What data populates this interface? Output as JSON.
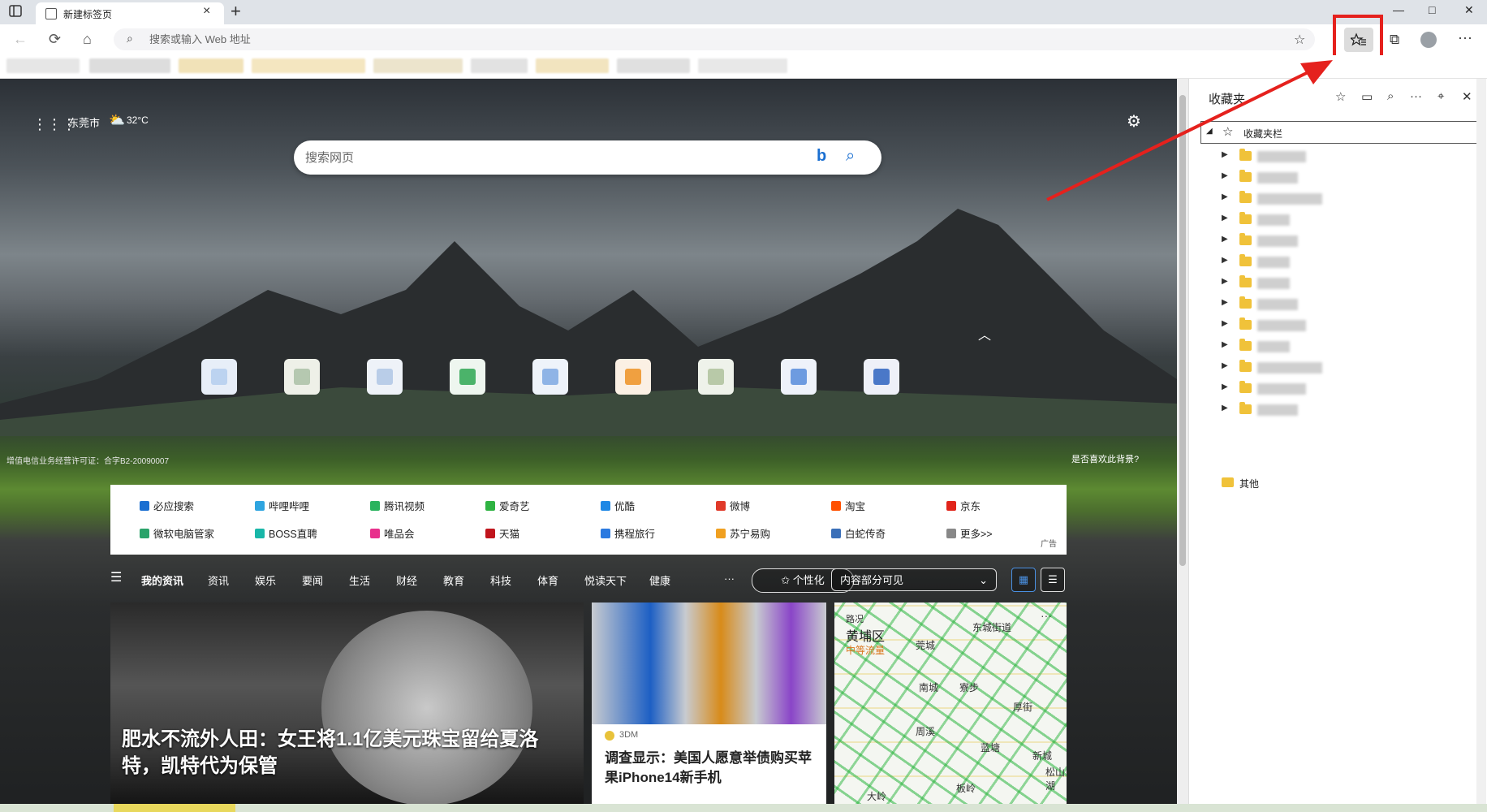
{
  "browser": {
    "tab_title": "新建标签页",
    "new_tab": "+",
    "address_placeholder": "搜索或输入 Web 地址",
    "window": {
      "minimize": "—",
      "maximize": "□",
      "close": "✕"
    }
  },
  "ntp": {
    "city": "东莞市",
    "temperature": "32°C",
    "search_placeholder": "搜索网页",
    "license": "增值电信业务经营许可证：合字B2-20090007",
    "like_background": "是否喜欢此背景?",
    "quick_links": [
      {
        "label": "必应搜索",
        "color": "#1a6fd1"
      },
      {
        "label": "哔哩哔哩",
        "color": "#2fa5e0"
      },
      {
        "label": "腾讯视频",
        "color": "#2ab35e"
      },
      {
        "label": "爱奇艺",
        "color": "#2fb342"
      },
      {
        "label": "优酷",
        "color": "#1e88e5"
      },
      {
        "label": "微博",
        "color": "#e03a2a"
      },
      {
        "label": "淘宝",
        "color": "#ff5000"
      },
      {
        "label": "京东",
        "color": "#e1251b"
      },
      {
        "label": "微软电脑管家",
        "color": "#2aa36a"
      },
      {
        "label": "BOSS直聘",
        "color": "#19b7a8"
      },
      {
        "label": "唯品会",
        "color": "#e8308c"
      },
      {
        "label": "天猫",
        "color": "#c0151c"
      },
      {
        "label": "携程旅行",
        "color": "#2b7ae0"
      },
      {
        "label": "苏宁易购",
        "color": "#f0a020"
      },
      {
        "label": "白蛇传奇",
        "color": "#3a6fb8"
      },
      {
        "label": "更多>>",
        "color": "#888888"
      }
    ],
    "ad_label": "广告",
    "news_tabs": [
      "我的资讯",
      "资讯",
      "娱乐",
      "要闻",
      "生活",
      "财经",
      "教育",
      "科技",
      "体育",
      "悦读天下",
      "健康"
    ],
    "news_more": "···",
    "personalize": "个性化",
    "visibility": "内容部分可见",
    "cards": {
      "main_title": "肥水不流外人田：女王将1.1亿美元珠宝留给夏洛特，凯特代为保管",
      "second_source": "3DM",
      "second_title": "调查显示：美国人愿意举债购买苹果iPhone14新手机",
      "map_label": "路况",
      "map_district": "黄埔区",
      "map_status": "中等流量",
      "map_places": [
        "东城街道",
        "莞城",
        "南城",
        "周溪",
        "寮步",
        "蓝塘",
        "新城",
        "厚街",
        "松山湖",
        "板岭",
        "大岭"
      ]
    }
  },
  "favorites_pane": {
    "title": "收藏夹",
    "root": "收藏夹栏",
    "folders": [
      40,
      30,
      60,
      20,
      30,
      20,
      20,
      30,
      40,
      20,
      60,
      40,
      30
    ],
    "other": "其他"
  }
}
